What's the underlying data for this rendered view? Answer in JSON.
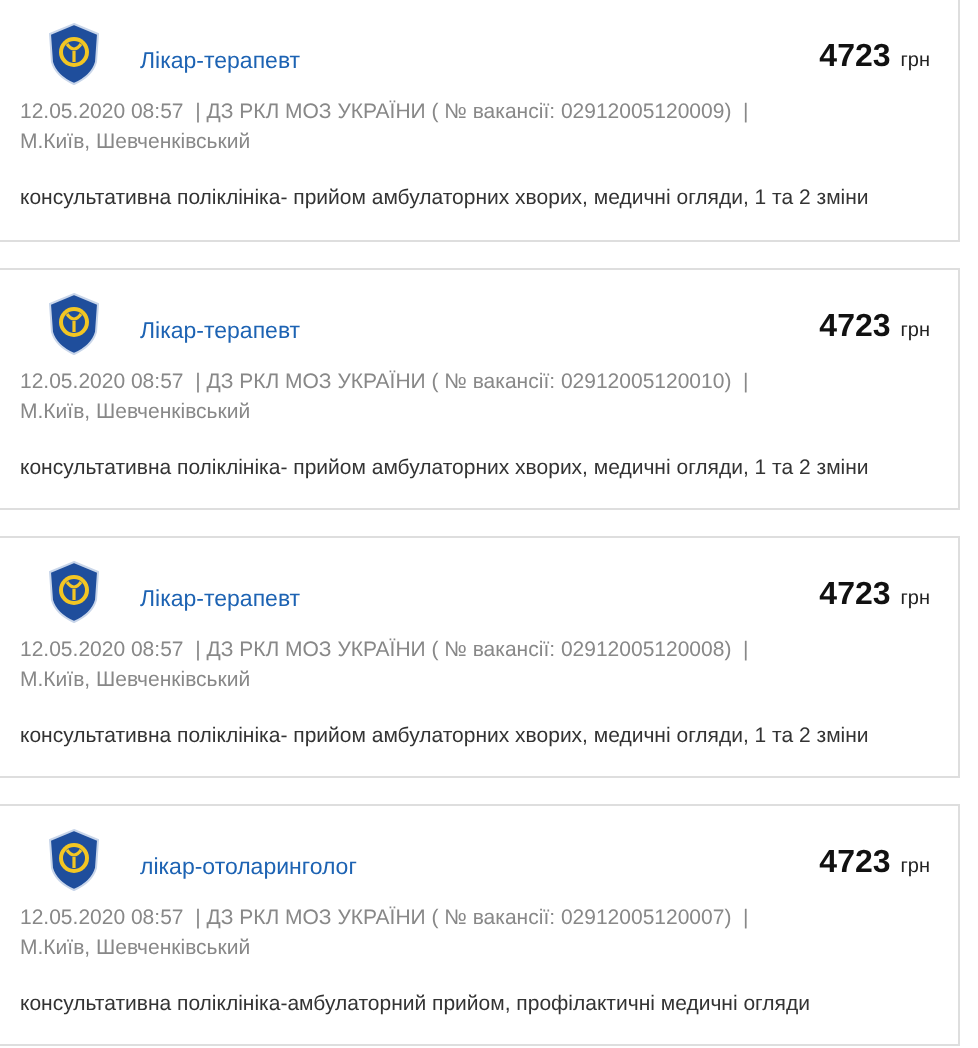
{
  "vacancies": [
    {
      "title": "Лікар-терапевт",
      "salary": "4723",
      "currency": "грн",
      "meta": "12.05.2020 08:57  | ДЗ РКЛ МОЗ УКРАЇНИ ( № вакансії: 02912005120009)  |",
      "location": "М.Київ, Шевченківський",
      "description": "консультативна поліклініка- прийом амбулаторних хворих, медичні огляди, 1 та 2 зміни"
    },
    {
      "title": "Лікар-терапевт",
      "salary": "4723",
      "currency": "грн",
      "meta": "12.05.2020 08:57  | ДЗ РКЛ МОЗ УКРАЇНИ ( № вакансії: 02912005120010)  |",
      "location": "М.Київ, Шевченківський",
      "description": "консультативна поліклініка- прийом амбулаторних хворих, медичні огляди, 1 та 2 зміни"
    },
    {
      "title": "Лікар-терапевт",
      "salary": "4723",
      "currency": "грн",
      "meta": "12.05.2020 08:57  | ДЗ РКЛ МОЗ УКРАЇНИ ( № вакансії: 02912005120008)  |",
      "location": "М.Київ, Шевченківський",
      "description": "консультативна поліклініка- прийом амбулаторних хворих, медичні огляди, 1 та 2 зміни"
    },
    {
      "title": "лікар-отоларинголог",
      "salary": "4723",
      "currency": "грн",
      "meta": "12.05.2020 08:57  | ДЗ РКЛ МОЗ УКРАЇНИ ( № вакансії: 02912005120007)  |",
      "location": "М.Київ, Шевченківський",
      "description": "консультативна поліклініка-амбулаторний прийом, профілактичні медичні огляди"
    }
  ]
}
